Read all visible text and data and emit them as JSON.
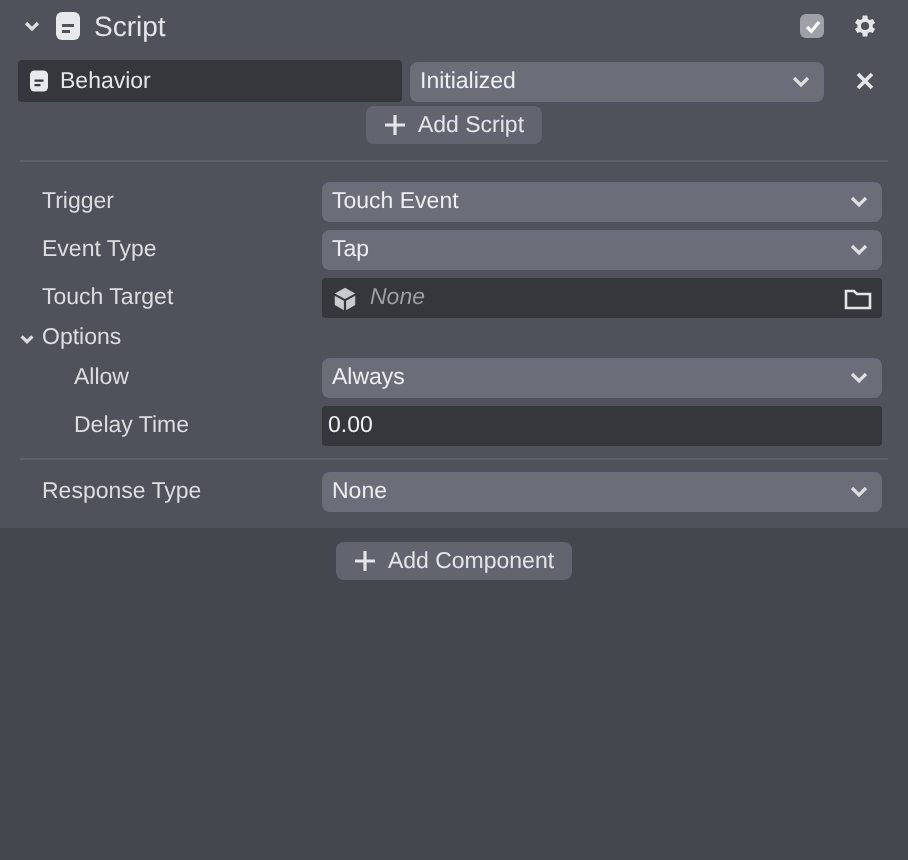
{
  "component": {
    "title": "Script",
    "expanded": true,
    "enabled": true
  },
  "script": {
    "name": "Behavior",
    "state": "Initialized"
  },
  "add_script": "Add Script",
  "properties": [
    {
      "kind": "dropdown",
      "label": "Trigger",
      "value": "Touch Event"
    },
    {
      "kind": "dropdown",
      "label": "Event Type",
      "value": "Tap"
    },
    {
      "kind": "object",
      "label": "Touch Target",
      "placeholder": "None"
    },
    {
      "kind": "group",
      "label": "Options",
      "expanded": true,
      "children": [
        {
          "kind": "dropdown",
          "label": "Allow",
          "value": "Always"
        },
        {
          "kind": "number",
          "label": "Delay Time",
          "value": "0.00"
        }
      ]
    },
    {
      "kind": "dropdown",
      "label": "Response Type",
      "value": "None"
    }
  ],
  "add_component": "Add Component"
}
